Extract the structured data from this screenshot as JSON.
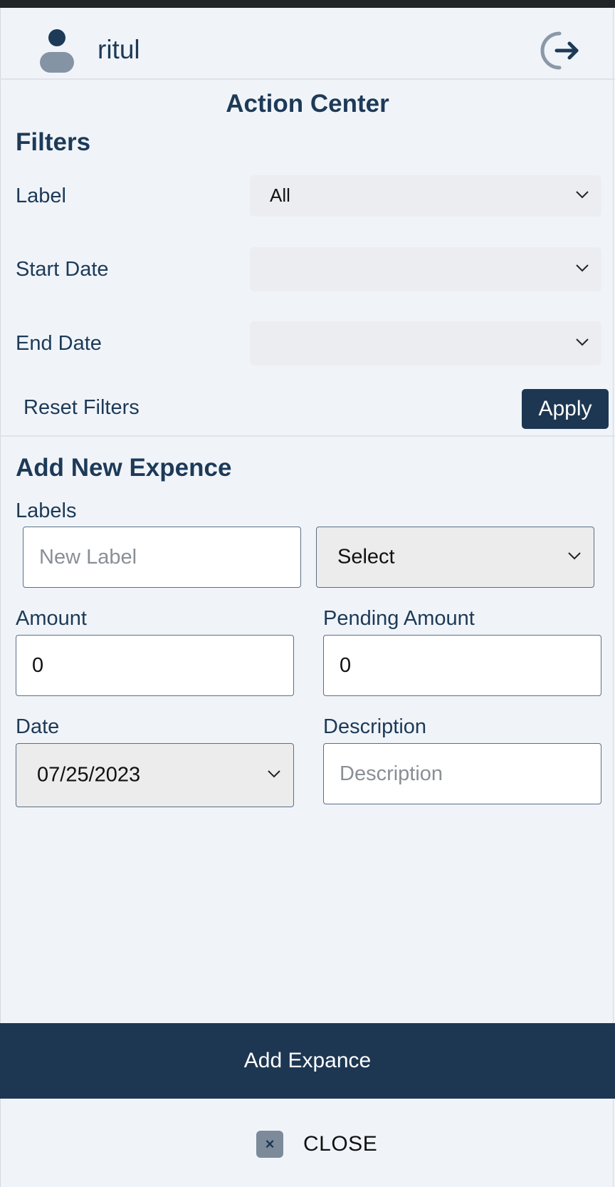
{
  "header": {
    "username": "ritul",
    "avatar_icon": "user-icon",
    "logout_icon": "logout-icon"
  },
  "page_title": "Action Center",
  "filters": {
    "heading": "Filters",
    "label_label": "Label",
    "label_value": "All",
    "start_date_label": "Start Date",
    "start_date_value": "",
    "end_date_label": "End Date",
    "end_date_value": "",
    "reset_label": "Reset Filters",
    "apply_label": "Apply"
  },
  "add_expense": {
    "heading": "Add New Expence",
    "labels_label": "Labels",
    "new_label_placeholder": "New Label",
    "new_label_value": "",
    "label_select_value": "Select",
    "amount_label": "Amount",
    "amount_value": "0",
    "pending_amount_label": "Pending Amount",
    "pending_amount_value": "0",
    "date_label": "Date",
    "date_value": "07/25/2023",
    "description_label": "Description",
    "description_placeholder": "Description",
    "description_value": "",
    "submit_label": "Add Expance"
  },
  "close": {
    "label": "CLOSE",
    "icon": "close-icon",
    "glyph": "×"
  },
  "colors": {
    "primary": "#1d3752",
    "background": "#f0f4f9",
    "text": "#1d3a57"
  }
}
